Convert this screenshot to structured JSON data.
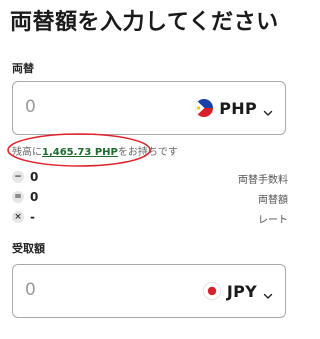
{
  "page": {
    "title": "両替額を入力してください"
  },
  "exchange": {
    "label": "両替",
    "amount_placeholder": "0",
    "currency": "PHP",
    "flag_icon": "philippines-flag-icon"
  },
  "balance": {
    "prefix": "残高に",
    "amount": "1,465.73 PHP",
    "suffix": "をお持ちです"
  },
  "breakdown": [
    {
      "op": "−",
      "value": "0",
      "label": "両替手数料"
    },
    {
      "op": "=",
      "value": "0",
      "label": "両替額"
    },
    {
      "op": "×",
      "value": "-",
      "label": "レート"
    }
  ],
  "receive": {
    "label": "受取額",
    "amount_placeholder": "0",
    "currency": "JPY",
    "flag_icon": "japan-flag-icon"
  },
  "colors": {
    "balance_link": "#1f6b2e",
    "annotation_circle": "#e0202a",
    "box_border": "#a9a9a9"
  }
}
